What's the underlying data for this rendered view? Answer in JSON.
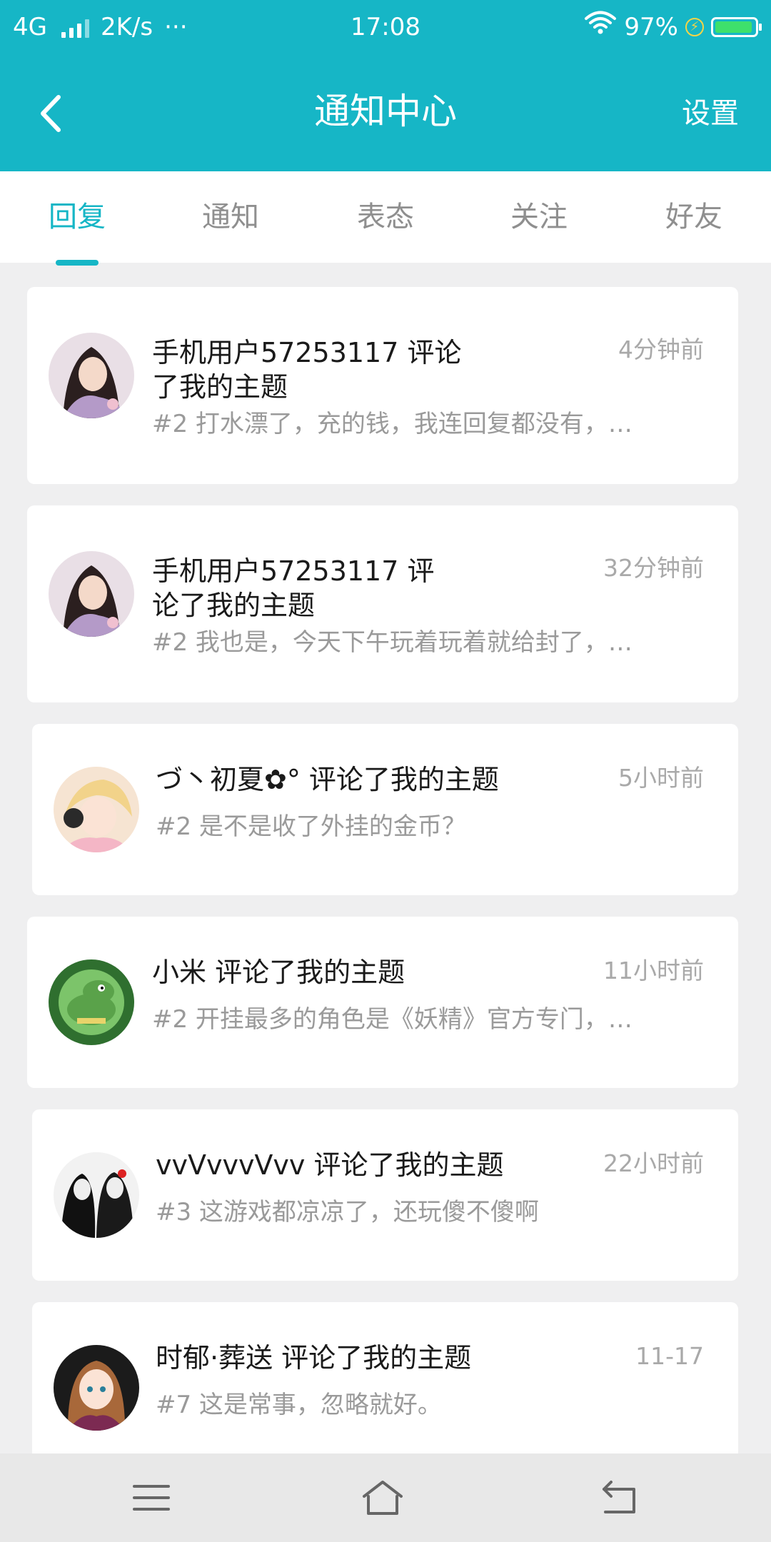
{
  "status_bar": {
    "network": "4G",
    "speed": "2K/s",
    "more": "···",
    "time": "17:08",
    "battery_percent": "97%"
  },
  "header": {
    "title": "通知中心",
    "settings_label": "设置"
  },
  "tabs": [
    {
      "label": "回复",
      "active": true
    },
    {
      "label": "通知",
      "active": false
    },
    {
      "label": "表态",
      "active": false
    },
    {
      "label": "关注",
      "active": false
    },
    {
      "label": "好友",
      "active": false
    }
  ],
  "notifications": [
    {
      "title": "手机用户57253117 评论了我的主题",
      "time": "4分钟前",
      "snippet": "#2 打水漂了，充的钱，我连回复都没有，…"
    },
    {
      "title": "手机用户57253117 评论了我的主题",
      "time": "32分钟前",
      "snippet": "#2 我也是，今天下午玩着玩着就给封了，…"
    },
    {
      "title": "づ丶初夏✿° 评论了我的主题",
      "time": "5小时前",
      "snippet": "#2 是不是收了外挂的金币？"
    },
    {
      "title": "小米 评论了我的主题",
      "time": "11小时前",
      "snippet": "#2 开挂最多的角色是《妖精》官方专门，…"
    },
    {
      "title": "vvVvvvVvv 评论了我的主题",
      "time": "22小时前",
      "snippet": "#3 这游戏都凉凉了，还玩傻不傻啊"
    },
    {
      "title": "时郁·葬送 评论了我的主题",
      "time": "11-17",
      "snippet": "#7 这是常事，忽略就好。"
    }
  ],
  "colors": {
    "accent": "#16b6c6",
    "background": "#efeff0",
    "battery": "#3ee06b"
  }
}
